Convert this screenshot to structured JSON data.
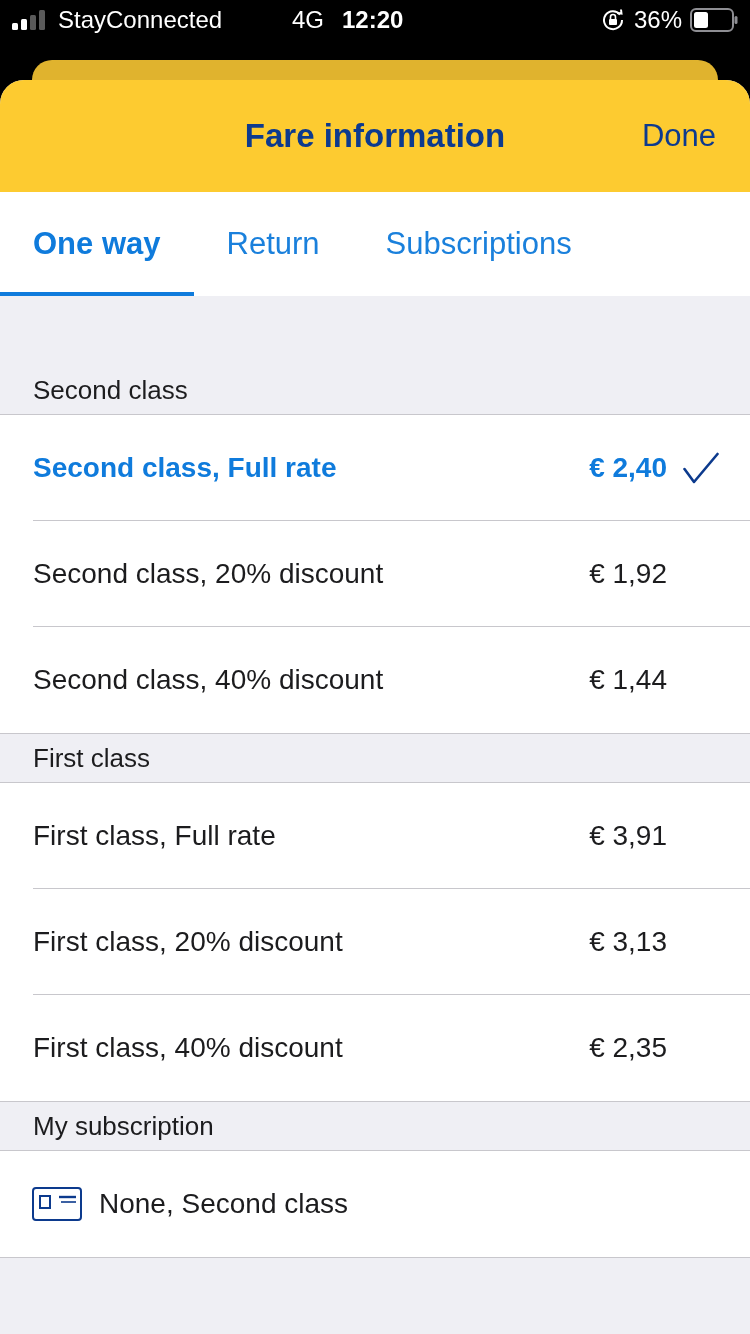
{
  "status_bar": {
    "carrier": "StayConnected",
    "network": "4G",
    "time": "12:20",
    "battery": "36%"
  },
  "header": {
    "title": "Fare information",
    "action": "Done"
  },
  "tabs": [
    {
      "label": "One way",
      "selected": true
    },
    {
      "label": "Return",
      "selected": false
    },
    {
      "label": "Subscriptions",
      "selected": false
    }
  ],
  "sections": [
    {
      "title": "Second class",
      "rows": [
        {
          "kind": "fare",
          "label": "Second class, Full rate",
          "price": "€ 2,40",
          "selected": true
        },
        {
          "kind": "fare",
          "label": "Second class, 20% discount",
          "price": "€ 1,92",
          "selected": false
        },
        {
          "kind": "fare",
          "label": "Second class, 40% discount",
          "price": "€ 1,44",
          "selected": false
        }
      ]
    },
    {
      "title": "First class",
      "rows": [
        {
          "kind": "fare",
          "label": "First class, Full rate",
          "price": "€ 3,91",
          "selected": false
        },
        {
          "kind": "fare",
          "label": "First class, 20% discount",
          "price": "€ 3,13",
          "selected": false
        },
        {
          "kind": "fare",
          "label": "First class, 40% discount",
          "price": "€ 2,35",
          "selected": false
        }
      ]
    },
    {
      "title": "My subscription",
      "rows": [
        {
          "kind": "subscription",
          "label": "None, Second class"
        }
      ]
    }
  ]
}
